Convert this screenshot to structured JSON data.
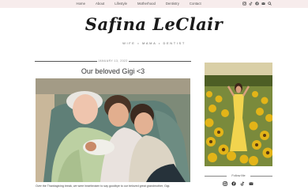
{
  "nav": {
    "items": [
      "Home",
      "About",
      "Lifestyle",
      "Motherhood",
      "Dentistry",
      "Contact"
    ]
  },
  "social_icons": [
    "instagram-icon",
    "tiktok-icon",
    "facebook-icon",
    "email-icon",
    "search-icon"
  ],
  "blog": {
    "title": "Safina LeClair",
    "tagline": "WIFE • MAMA • DENTIST"
  },
  "post": {
    "date": "JANUARY 13, 2022",
    "title": "Our beloved Gigi <3",
    "excerpt": "Over the Thanksgiving break, we were heartbroken to say goodbye to our beloved great grandmother, Gigi."
  },
  "sidebar": {
    "follow_label": "Follow Me",
    "social_icons": [
      "instagram-icon",
      "facebook-icon",
      "tiktok-icon",
      "email-icon"
    ]
  },
  "colors": {
    "topbar": "#f7ecec",
    "text": "#333333"
  }
}
